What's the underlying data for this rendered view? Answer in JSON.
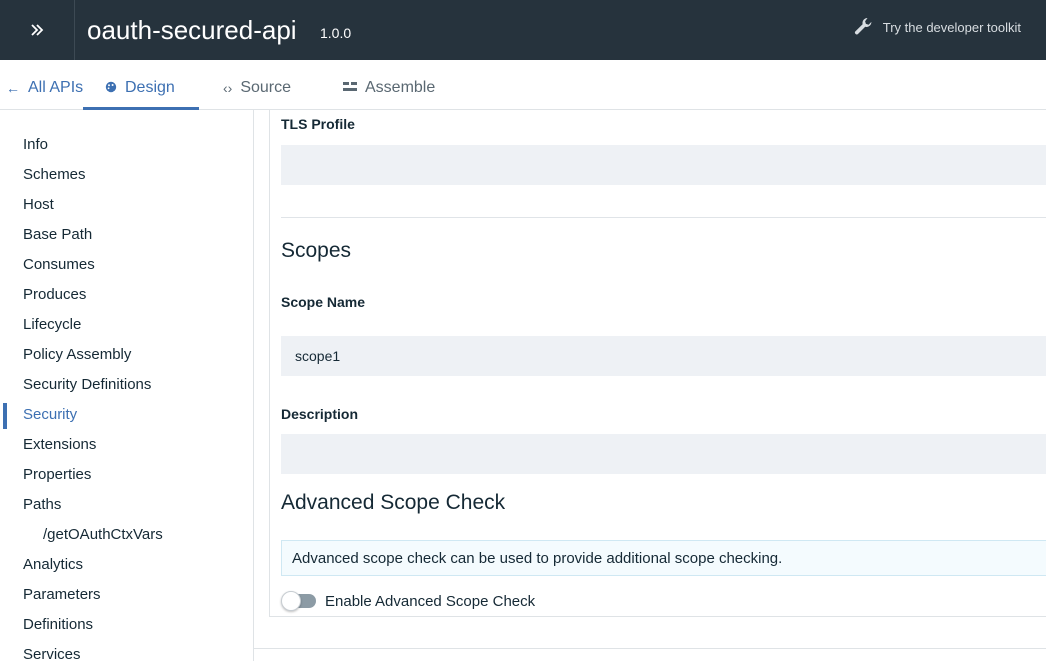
{
  "header": {
    "expand_icon": "double-chevron-right-icon",
    "title": "oauth-secured-api",
    "version": "1.0.0",
    "toolkit_icon": "wrench-icon",
    "toolkit_label": "Try the developer toolkit"
  },
  "tabs": {
    "back_label": "All APIs",
    "design_label": "Design",
    "source_label": "Source",
    "assemble_label": "Assemble",
    "active": "Design"
  },
  "sidebar": {
    "items": [
      {
        "label": "Info"
      },
      {
        "label": "Schemes"
      },
      {
        "label": "Host"
      },
      {
        "label": "Base Path"
      },
      {
        "label": "Consumes"
      },
      {
        "label": "Produces"
      },
      {
        "label": "Lifecycle"
      },
      {
        "label": "Policy Assembly"
      },
      {
        "label": "Security Definitions"
      },
      {
        "label": "Security"
      },
      {
        "label": "Extensions"
      },
      {
        "label": "Properties"
      },
      {
        "label": "Paths"
      },
      {
        "label": "/getOAuthCtxVars"
      },
      {
        "label": "Analytics"
      },
      {
        "label": "Parameters"
      },
      {
        "label": "Definitions"
      },
      {
        "label": "Services"
      }
    ],
    "active_item": "Security"
  },
  "main": {
    "tls_profile_label": "TLS Profile",
    "tls_profile_value": "",
    "scopes_title": "Scopes",
    "scope_name_label": "Scope Name",
    "scope_name_value": "scope1",
    "description_label": "Description",
    "description_value": "",
    "advanced_title": "Advanced Scope Check",
    "advanced_notice": "Advanced scope check can be used to provide additional scope checking.",
    "toggle_label": "Enable Advanced Scope Check",
    "toggle_on": false
  },
  "colors": {
    "header_bg": "#26333d",
    "accent": "#3d70b2",
    "field_bg": "#eef1f5"
  }
}
